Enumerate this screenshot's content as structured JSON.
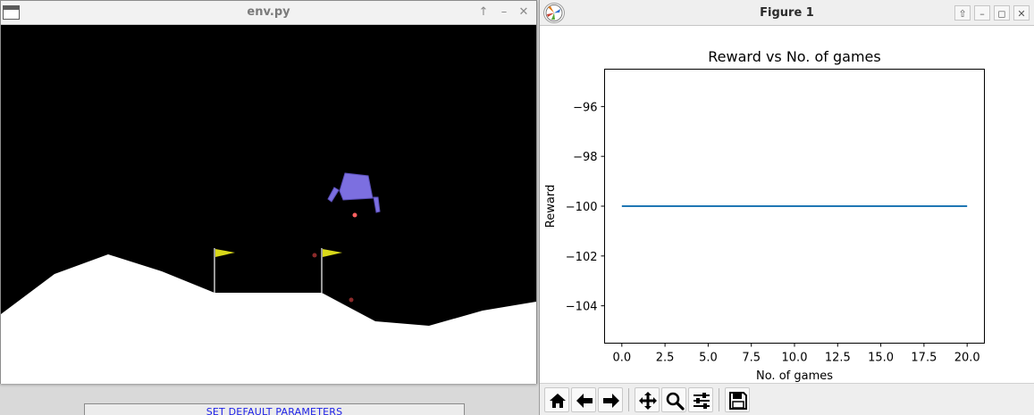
{
  "env_window": {
    "title": "env.py",
    "buttons": {
      "up": "↑",
      "minimize": "–",
      "close": "✕"
    }
  },
  "figure_window": {
    "title": "Figure 1",
    "buttons": {
      "up": "⇧",
      "minimize": "–",
      "maximize": "◻",
      "close": "✕"
    }
  },
  "toolbar": {
    "icons": [
      "home-icon",
      "back-arrow-icon",
      "forward-arrow-icon",
      "pan-icon",
      "zoom-icon",
      "configure-subplots-icon",
      "save-icon"
    ]
  },
  "bottom_panel": {
    "button_label": "SET DEFAULT PARAMETERS"
  },
  "colors": {
    "lander": "#7c6fe0",
    "flag": "#d8d81a",
    "line": "#1f77b4"
  },
  "chart_data": {
    "type": "line",
    "title": "Reward vs No. of games",
    "xlabel": "No. of games",
    "ylabel": "Reward",
    "xlim": [
      -1,
      21
    ],
    "ylim": [
      -105.5,
      -94.5
    ],
    "xticks": [
      0.0,
      2.5,
      5.0,
      7.5,
      10.0,
      12.5,
      15.0,
      17.5,
      20.0
    ],
    "xtick_labels": [
      "0.0",
      "2.5",
      "5.0",
      "7.5",
      "10.0",
      "12.5",
      "15.0",
      "17.5",
      "20.0"
    ],
    "yticks": [
      -96,
      -98,
      -100,
      -102,
      -104
    ],
    "ytick_labels": [
      "−96",
      "−98",
      "−100",
      "−102",
      "−104"
    ],
    "series": [
      {
        "x": [
          0,
          1,
          2,
          3,
          4,
          5,
          6,
          7,
          8,
          9,
          10,
          11,
          12,
          13,
          14,
          15,
          16,
          17,
          18,
          19,
          20
        ],
        "y": [
          -100,
          -100,
          -100,
          -100,
          -100,
          -100,
          -100,
          -100,
          -100,
          -100,
          -100,
          -100,
          -100,
          -100,
          -100,
          -100,
          -100,
          -100,
          -100,
          -100,
          -100
        ]
      }
    ],
    "grid": false,
    "legend": "none"
  }
}
